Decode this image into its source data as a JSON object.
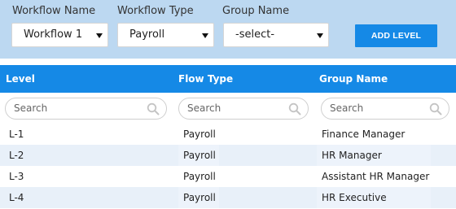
{
  "filters": {
    "workflow_name_label": "Workflow Name",
    "workflow_type_label": "Workflow Type",
    "group_name_label": "Group Name",
    "workflow_name_value": "Workflow 1",
    "workflow_type_value": "Payroll",
    "group_name_value": "-select-",
    "add_level_label": "ADD LEVEL"
  },
  "table": {
    "headers": {
      "level": "Level",
      "flow_type": "Flow Type",
      "group_name": "Group Name"
    },
    "search_placeholder": "Search",
    "rows": [
      {
        "level": "L-1",
        "flow_type": "Payroll",
        "group_name": "Finance Manager"
      },
      {
        "level": "L-2",
        "flow_type": "Payroll",
        "group_name": "HR Manager"
      },
      {
        "level": "L-3",
        "flow_type": "Payroll",
        "group_name": "Assistant HR Manager"
      },
      {
        "level": "L-4",
        "flow_type": "Payroll",
        "group_name": "HR Executive"
      }
    ]
  },
  "colors": {
    "accent": "#1589e6",
    "filter_bar": "#bcd8f1",
    "row_alt": "#e8f0f9"
  },
  "icons": {
    "dropdown": "chevron-down-icon",
    "search": "search-icon"
  }
}
